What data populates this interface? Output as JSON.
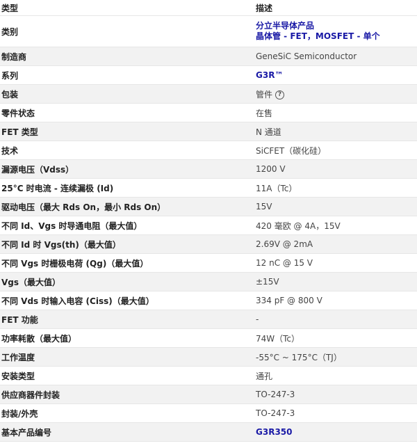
{
  "header": {
    "type_label": "类型",
    "desc_label": "描述"
  },
  "rows": [
    {
      "attr": "类别",
      "lines": [
        "分立半导体产品",
        "晶体管 - FET，MOSFET - 单个"
      ]
    },
    {
      "attr": "制造商",
      "value": "GeneSiC Semiconductor"
    },
    {
      "attr": "系列",
      "value": "G3R™"
    },
    {
      "attr": "包装",
      "value": "管件"
    },
    {
      "attr": "零件状态",
      "value": "在售"
    },
    {
      "attr": "FET 类型",
      "value": "N 通道"
    },
    {
      "attr": "技术",
      "value": "SiCFET（碳化硅）"
    },
    {
      "attr": "漏源电压（Vdss）",
      "value": "1200 V"
    },
    {
      "attr": "25°C 时电流 - 连续漏极 (Id)",
      "value": "11A（Tc）"
    },
    {
      "attr": "驱动电压（最大 Rds On，最小 Rds On）",
      "value": "15V"
    },
    {
      "attr": "不同 Id、Vgs 时导通电阻（最大值）",
      "value": "420 毫欧 @ 4A，15V"
    },
    {
      "attr": "不同 Id 时 Vgs(th)（最大值）",
      "value": "2.69V @ 2mA"
    },
    {
      "attr": "不同 Vgs 时栅极电荷 (Qg)（最大值）",
      "value": "12 nC @ 15 V"
    },
    {
      "attr": "Vgs（最大值）",
      "value": "±15V"
    },
    {
      "attr": "不同 Vds 时输入电容 (Ciss)（最大值）",
      "value": "334 pF @ 800 V"
    },
    {
      "attr": "FET 功能",
      "value": "-"
    },
    {
      "attr": "功率耗散（最大值）",
      "value": "74W（Tc）"
    },
    {
      "attr": "工作温度",
      "value": "-55°C ~ 175°C（TJ）"
    },
    {
      "attr": "安装类型",
      "value": "通孔"
    },
    {
      "attr": "供应商器件封装",
      "value": "TO-247-3"
    },
    {
      "attr": "封装/外壳",
      "value": "TO-247-3"
    },
    {
      "attr": "基本产品编号",
      "value": "G3R350"
    }
  ],
  "icons": {
    "help": "question-circle-icon"
  },
  "colors": {
    "link": "#1a1aa6",
    "row_alt": "#f2f2f2"
  }
}
